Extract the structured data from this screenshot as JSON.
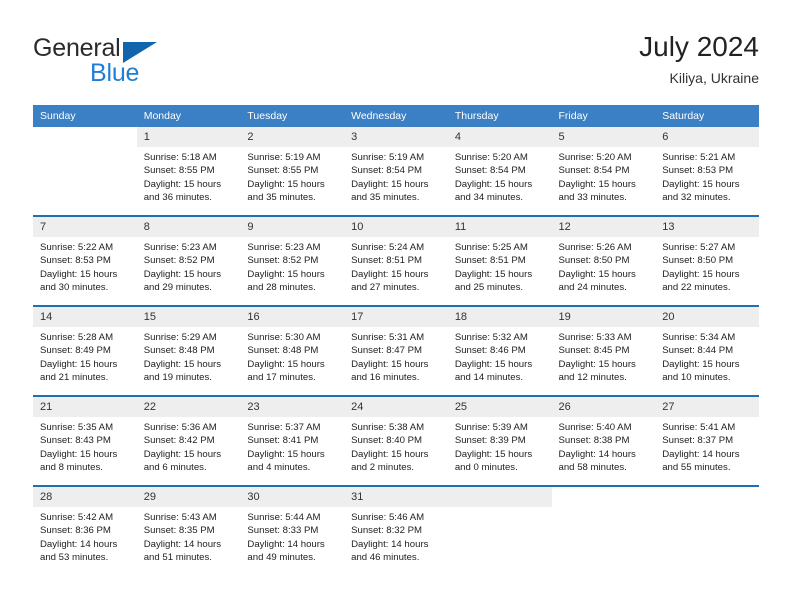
{
  "brand": {
    "name_top": "General",
    "name_bottom": "Blue",
    "triangle_color": "#1165ad",
    "blue_color": "#1f7fd4"
  },
  "header": {
    "title": "July 2024",
    "subtitle": "Kiliya, Ukraine"
  },
  "theme": {
    "header_row_bg": "#3b7fc4",
    "row_divider": "#1f6fb2",
    "daynum_bg": "#eeeeee"
  },
  "weekdays": [
    "Sunday",
    "Monday",
    "Tuesday",
    "Wednesday",
    "Thursday",
    "Friday",
    "Saturday"
  ],
  "weeks": [
    [
      {
        "day": "",
        "blank": true
      },
      {
        "day": "1",
        "sunrise": "Sunrise: 5:18 AM",
        "sunset": "Sunset: 8:55 PM",
        "daylight1": "Daylight: 15 hours",
        "daylight2": "and 36 minutes."
      },
      {
        "day": "2",
        "sunrise": "Sunrise: 5:19 AM",
        "sunset": "Sunset: 8:55 PM",
        "daylight1": "Daylight: 15 hours",
        "daylight2": "and 35 minutes."
      },
      {
        "day": "3",
        "sunrise": "Sunrise: 5:19 AM",
        "sunset": "Sunset: 8:54 PM",
        "daylight1": "Daylight: 15 hours",
        "daylight2": "and 35 minutes."
      },
      {
        "day": "4",
        "sunrise": "Sunrise: 5:20 AM",
        "sunset": "Sunset: 8:54 PM",
        "daylight1": "Daylight: 15 hours",
        "daylight2": "and 34 minutes."
      },
      {
        "day": "5",
        "sunrise": "Sunrise: 5:20 AM",
        "sunset": "Sunset: 8:54 PM",
        "daylight1": "Daylight: 15 hours",
        "daylight2": "and 33 minutes."
      },
      {
        "day": "6",
        "sunrise": "Sunrise: 5:21 AM",
        "sunset": "Sunset: 8:53 PM",
        "daylight1": "Daylight: 15 hours",
        "daylight2": "and 32 minutes."
      }
    ],
    [
      {
        "day": "7",
        "sunrise": "Sunrise: 5:22 AM",
        "sunset": "Sunset: 8:53 PM",
        "daylight1": "Daylight: 15 hours",
        "daylight2": "and 30 minutes."
      },
      {
        "day": "8",
        "sunrise": "Sunrise: 5:23 AM",
        "sunset": "Sunset: 8:52 PM",
        "daylight1": "Daylight: 15 hours",
        "daylight2": "and 29 minutes."
      },
      {
        "day": "9",
        "sunrise": "Sunrise: 5:23 AM",
        "sunset": "Sunset: 8:52 PM",
        "daylight1": "Daylight: 15 hours",
        "daylight2": "and 28 minutes."
      },
      {
        "day": "10",
        "sunrise": "Sunrise: 5:24 AM",
        "sunset": "Sunset: 8:51 PM",
        "daylight1": "Daylight: 15 hours",
        "daylight2": "and 27 minutes."
      },
      {
        "day": "11",
        "sunrise": "Sunrise: 5:25 AM",
        "sunset": "Sunset: 8:51 PM",
        "daylight1": "Daylight: 15 hours",
        "daylight2": "and 25 minutes."
      },
      {
        "day": "12",
        "sunrise": "Sunrise: 5:26 AM",
        "sunset": "Sunset: 8:50 PM",
        "daylight1": "Daylight: 15 hours",
        "daylight2": "and 24 minutes."
      },
      {
        "day": "13",
        "sunrise": "Sunrise: 5:27 AM",
        "sunset": "Sunset: 8:50 PM",
        "daylight1": "Daylight: 15 hours",
        "daylight2": "and 22 minutes."
      }
    ],
    [
      {
        "day": "14",
        "sunrise": "Sunrise: 5:28 AM",
        "sunset": "Sunset: 8:49 PM",
        "daylight1": "Daylight: 15 hours",
        "daylight2": "and 21 minutes."
      },
      {
        "day": "15",
        "sunrise": "Sunrise: 5:29 AM",
        "sunset": "Sunset: 8:48 PM",
        "daylight1": "Daylight: 15 hours",
        "daylight2": "and 19 minutes."
      },
      {
        "day": "16",
        "sunrise": "Sunrise: 5:30 AM",
        "sunset": "Sunset: 8:48 PM",
        "daylight1": "Daylight: 15 hours",
        "daylight2": "and 17 minutes."
      },
      {
        "day": "17",
        "sunrise": "Sunrise: 5:31 AM",
        "sunset": "Sunset: 8:47 PM",
        "daylight1": "Daylight: 15 hours",
        "daylight2": "and 16 minutes."
      },
      {
        "day": "18",
        "sunrise": "Sunrise: 5:32 AM",
        "sunset": "Sunset: 8:46 PM",
        "daylight1": "Daylight: 15 hours",
        "daylight2": "and 14 minutes."
      },
      {
        "day": "19",
        "sunrise": "Sunrise: 5:33 AM",
        "sunset": "Sunset: 8:45 PM",
        "daylight1": "Daylight: 15 hours",
        "daylight2": "and 12 minutes."
      },
      {
        "day": "20",
        "sunrise": "Sunrise: 5:34 AM",
        "sunset": "Sunset: 8:44 PM",
        "daylight1": "Daylight: 15 hours",
        "daylight2": "and 10 minutes."
      }
    ],
    [
      {
        "day": "21",
        "sunrise": "Sunrise: 5:35 AM",
        "sunset": "Sunset: 8:43 PM",
        "daylight1": "Daylight: 15 hours",
        "daylight2": "and 8 minutes."
      },
      {
        "day": "22",
        "sunrise": "Sunrise: 5:36 AM",
        "sunset": "Sunset: 8:42 PM",
        "daylight1": "Daylight: 15 hours",
        "daylight2": "and 6 minutes."
      },
      {
        "day": "23",
        "sunrise": "Sunrise: 5:37 AM",
        "sunset": "Sunset: 8:41 PM",
        "daylight1": "Daylight: 15 hours",
        "daylight2": "and 4 minutes."
      },
      {
        "day": "24",
        "sunrise": "Sunrise: 5:38 AM",
        "sunset": "Sunset: 8:40 PM",
        "daylight1": "Daylight: 15 hours",
        "daylight2": "and 2 minutes."
      },
      {
        "day": "25",
        "sunrise": "Sunrise: 5:39 AM",
        "sunset": "Sunset: 8:39 PM",
        "daylight1": "Daylight: 15 hours",
        "daylight2": "and 0 minutes."
      },
      {
        "day": "26",
        "sunrise": "Sunrise: 5:40 AM",
        "sunset": "Sunset: 8:38 PM",
        "daylight1": "Daylight: 14 hours",
        "daylight2": "and 58 minutes."
      },
      {
        "day": "27",
        "sunrise": "Sunrise: 5:41 AM",
        "sunset": "Sunset: 8:37 PM",
        "daylight1": "Daylight: 14 hours",
        "daylight2": "and 55 minutes."
      }
    ],
    [
      {
        "day": "28",
        "sunrise": "Sunrise: 5:42 AM",
        "sunset": "Sunset: 8:36 PM",
        "daylight1": "Daylight: 14 hours",
        "daylight2": "and 53 minutes."
      },
      {
        "day": "29",
        "sunrise": "Sunrise: 5:43 AM",
        "sunset": "Sunset: 8:35 PM",
        "daylight1": "Daylight: 14 hours",
        "daylight2": "and 51 minutes."
      },
      {
        "day": "30",
        "sunrise": "Sunrise: 5:44 AM",
        "sunset": "Sunset: 8:33 PM",
        "daylight1": "Daylight: 14 hours",
        "daylight2": "and 49 minutes."
      },
      {
        "day": "31",
        "sunrise": "Sunrise: 5:46 AM",
        "sunset": "Sunset: 8:32 PM",
        "daylight1": "Daylight: 14 hours",
        "daylight2": "and 46 minutes."
      },
      {
        "day": "",
        "empty": true
      },
      {
        "day": "",
        "blank": true
      },
      {
        "day": "",
        "blank": true
      }
    ]
  ]
}
